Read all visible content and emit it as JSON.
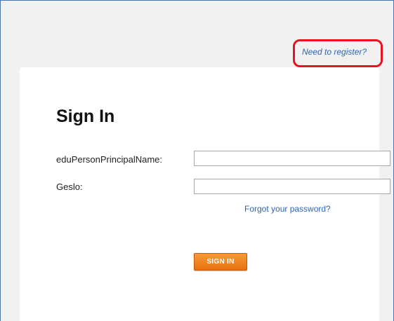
{
  "header": {
    "register_link": "Need to register?"
  },
  "form": {
    "title": "Sign In",
    "username_label": "eduPersonPrincipalName:",
    "username_value": "",
    "password_label": "Geslo:",
    "password_value": "",
    "forgot_link": "Forgot your password?",
    "submit_label": "SIGN IN"
  },
  "colors": {
    "link": "#2e64b0",
    "highlight": "#e5141f",
    "button": "#f08424",
    "page_background": "#f1f1f1",
    "card_background": "#ffffff",
    "frame_border": "#4a74b4"
  }
}
